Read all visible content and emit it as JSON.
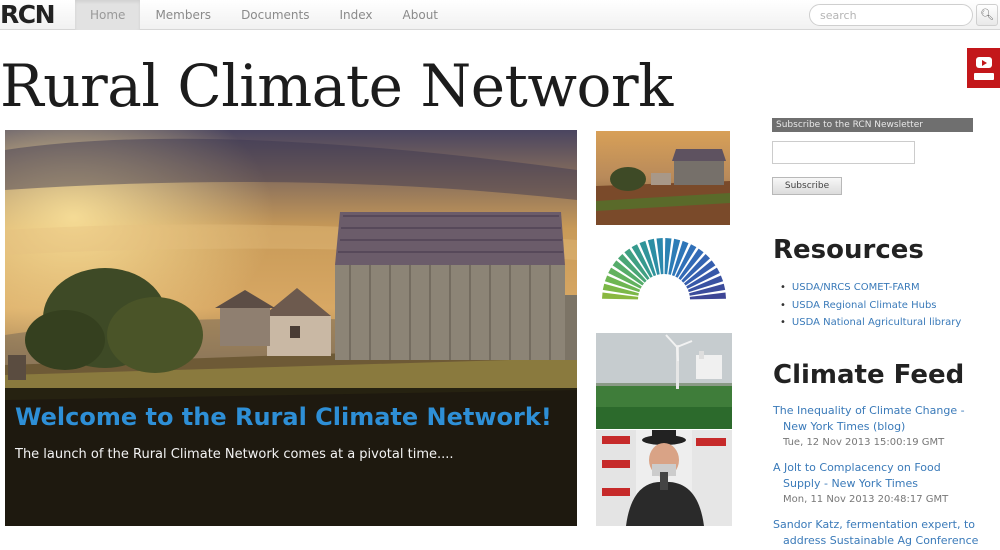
{
  "navbar": {
    "brand": "RCN",
    "items": [
      {
        "label": "Home",
        "active": true
      },
      {
        "label": "Members",
        "active": false
      },
      {
        "label": "Documents",
        "active": false
      },
      {
        "label": "Index",
        "active": false
      },
      {
        "label": "About",
        "active": false
      }
    ],
    "search_placeholder": "search"
  },
  "site_title": "Rural Climate Network",
  "hero": {
    "heading": "Welcome to the Rural Climate Network!",
    "text": "The launch of the Rural Climate Network comes at a pivotal time...."
  },
  "newsletter": {
    "label": "Subscribe to the RCN Newsletter",
    "button": "Subscribe"
  },
  "resources": {
    "heading": "Resources",
    "items": [
      "USDA/NRCS COMET-FARM",
      "USDA Regional Climate Hubs",
      "USDA National Agricultural library"
    ]
  },
  "climate_feed": {
    "heading": "Climate Feed",
    "items": [
      {
        "title_1": "The Inequality of Climate Change -",
        "title_2": "New York Times (blog)",
        "date": "Tue, 12 Nov 2013 15:00:19 GMT"
      },
      {
        "title_1": "A Jolt to Complacency on Food",
        "title_2": "Supply - New York Times",
        "date": "Mon, 11 Nov 2013 20:48:17 GMT"
      },
      {
        "title_1": "Sandor Katz, fermentation expert, to",
        "title_2": "address Sustainable Ag Conference",
        "date": ""
      }
    ]
  }
}
